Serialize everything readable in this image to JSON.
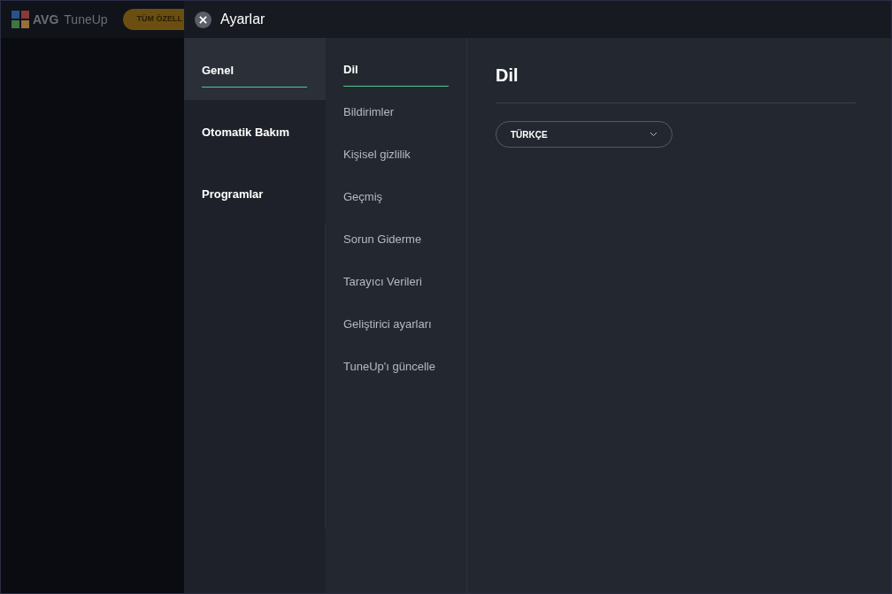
{
  "app": {
    "brand": "AVG",
    "product": "TuneUp",
    "button": "TÜM ÖZELL"
  },
  "panel": {
    "title": "Ayarlar"
  },
  "categories": [
    {
      "label": "Genel",
      "selected": true
    },
    {
      "label": "Otomatik Bakım",
      "selected": false
    },
    {
      "label": "Programlar",
      "selected": false
    }
  ],
  "sections": [
    {
      "label": "Dil",
      "selected": true
    },
    {
      "label": "Bildirimler",
      "selected": false
    },
    {
      "label": "Kişisel gizlilik",
      "selected": false
    },
    {
      "label": "Geçmiş",
      "selected": false
    },
    {
      "label": "Sorun Giderme",
      "selected": false
    },
    {
      "label": "Tarayıcı Verileri",
      "selected": false
    },
    {
      "label": "Geliştirici ayarları",
      "selected": false
    },
    {
      "label": "TuneUp'ı güncelle",
      "selected": false
    }
  ],
  "content": {
    "heading": "Dil",
    "language_select": {
      "value": "TÜRKÇE"
    }
  }
}
